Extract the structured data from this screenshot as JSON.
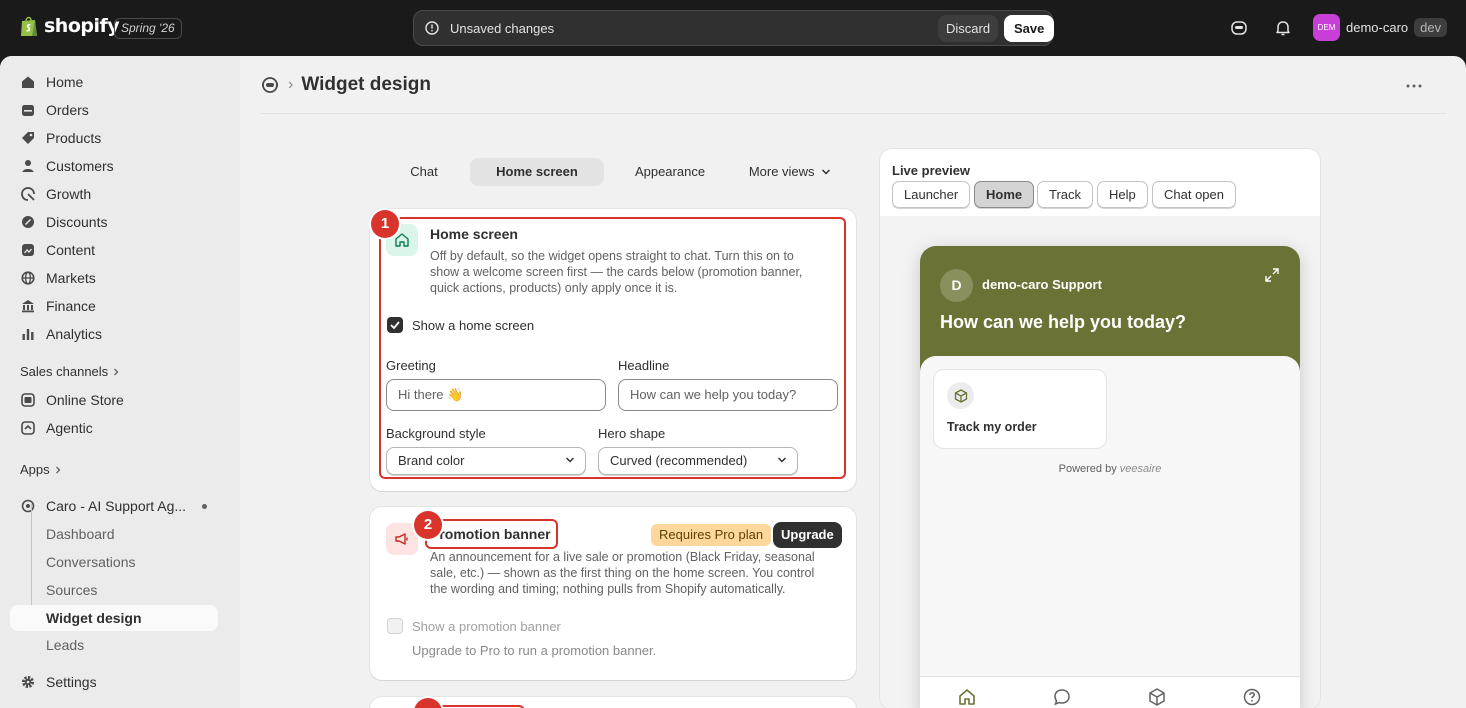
{
  "topbar": {
    "logo_text": "shopify",
    "edition": "Spring '26",
    "unsaved_text": "Unsaved changes",
    "discard_label": "Discard",
    "save_label": "Save",
    "store_initials": "DEM",
    "store_name": "demo-caro",
    "store_badge": "dev",
    "avatar_color": "#c73fd6"
  },
  "sidebar": {
    "items": [
      {
        "label": "Home",
        "icon": "home-icon"
      },
      {
        "label": "Orders",
        "icon": "inbox-icon"
      },
      {
        "label": "Products",
        "icon": "tag-icon"
      },
      {
        "label": "Customers",
        "icon": "person-icon"
      },
      {
        "label": "Growth",
        "icon": "growth-icon"
      },
      {
        "label": "Discounts",
        "icon": "discount-icon"
      },
      {
        "label": "Content",
        "icon": "content-icon"
      },
      {
        "label": "Markets",
        "icon": "globe-icon"
      },
      {
        "label": "Finance",
        "icon": "bank-icon"
      },
      {
        "label": "Analytics",
        "icon": "bar-chart-icon"
      }
    ],
    "sales_channels_label": "Sales channels",
    "channels": [
      {
        "label": "Online Store",
        "icon": "store-icon"
      },
      {
        "label": "Agentic",
        "icon": "agentic-icon"
      }
    ],
    "apps_label": "Apps",
    "app_name": "Caro - AI Support Ag...",
    "app_subitems": [
      "Dashboard",
      "Conversations",
      "Sources",
      "Widget design",
      "Leads"
    ],
    "settings_label": "Settings"
  },
  "page": {
    "title": "Widget design"
  },
  "tabs": [
    "Chat",
    "Home screen",
    "Appearance",
    "More views"
  ],
  "home_card": {
    "step": "1",
    "title": "Home screen",
    "desc_lines": [
      "Off by default, so the widget opens straight to chat. Turn this on to",
      "show a welcome screen first — the cards below (promotion banner,",
      "quick actions, products) only apply once it is."
    ],
    "checkbox_label": "Show a home screen",
    "greeting_label": "Greeting",
    "greeting_value": "Hi there 👋",
    "headline_label": "Headline",
    "headline_placeholder": "How can we help you today?",
    "bg_style_label": "Background style",
    "bg_style_value": "Brand color",
    "hero_shape_label": "Hero shape",
    "hero_shape_value": "Curved (recommended)"
  },
  "promo_card": {
    "step": "2",
    "title": "Promotion banner",
    "badge": "Requires Pro plan",
    "upgrade_label": "Upgrade",
    "desc_lines": [
      "An announcement for a live sale or promotion (Black Friday, seasonal",
      "sale, etc.) — shown as the first thing on the home screen. You control",
      "the wording and timing; nothing pulls from Shopify automatically."
    ],
    "checkbox_label": "Show a promotion banner",
    "upgrade_hint": "Upgrade to Pro to run a promotion banner."
  },
  "preview": {
    "title": "Live preview",
    "buttons": [
      "Launcher",
      "Home",
      "Track",
      "Help",
      "Chat open"
    ],
    "widget": {
      "avatar_letter": "D",
      "support_name": "demo-caro Support",
      "headline": "How can we help you today?",
      "card_label": "Track my order",
      "powered_by": "Powered by",
      "brand": "veesaire",
      "hero_color": "#6b7235"
    }
  },
  "colors": {
    "highlight": "#d9342b",
    "home_icon_bg": "#dcf5ea",
    "promo_icon_bg": "#fde3e1"
  }
}
